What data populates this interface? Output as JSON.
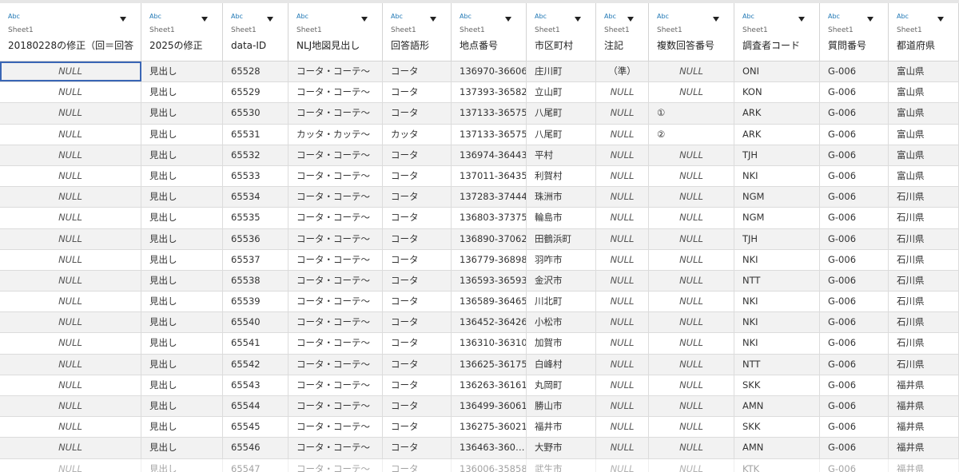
{
  "columns": [
    {
      "type": "Abc",
      "source": "Sheet1",
      "name": "20180228の修正（回＝回答"
    },
    {
      "type": "Abc",
      "source": "Sheet1",
      "name": "2025の修正"
    },
    {
      "type": "Abc",
      "source": "Sheet1",
      "name": "data-ID"
    },
    {
      "type": "Abc",
      "source": "Sheet1",
      "name": "NLJ地図見出し"
    },
    {
      "type": "Abc",
      "source": "Sheet1",
      "name": "回答語形"
    },
    {
      "type": "Abc",
      "source": "Sheet1",
      "name": "地点番号"
    },
    {
      "type": "Abc",
      "source": "Sheet1",
      "name": "市区町村"
    },
    {
      "type": "Abc",
      "source": "Sheet1",
      "name": "注記"
    },
    {
      "type": "Abc",
      "source": "Sheet1",
      "name": "複数回答番号"
    },
    {
      "type": "Abc",
      "source": "Sheet1",
      "name": "調査者コード"
    },
    {
      "type": "Abc",
      "source": "Sheet1",
      "name": "質問番号"
    },
    {
      "type": "Abc",
      "source": "Sheet1",
      "name": "都道府県"
    }
  ],
  "rows": [
    [
      "NULL",
      "見出し",
      "65528",
      "コータ・コーテ〜",
      "コータ",
      "136970-36606",
      "庄川町",
      "（準）",
      "NULL",
      "ONI",
      "G-006",
      "富山県"
    ],
    [
      "NULL",
      "見出し",
      "65529",
      "コータ・コーテ〜",
      "コータ",
      "137393-36582",
      "立山町",
      "NULL",
      "NULL",
      "KON",
      "G-006",
      "富山県"
    ],
    [
      "NULL",
      "見出し",
      "65530",
      "コータ・コーテ〜",
      "コータ",
      "137133-36575",
      "八尾町",
      "NULL",
      "①",
      "ARK",
      "G-006",
      "富山県"
    ],
    [
      "NULL",
      "見出し",
      "65531",
      "カッタ・カッテ〜",
      "カッタ",
      "137133-36575",
      "八尾町",
      "NULL",
      "②",
      "ARK",
      "G-006",
      "富山県"
    ],
    [
      "NULL",
      "見出し",
      "65532",
      "コータ・コーテ〜",
      "コータ",
      "136974-36443",
      "平村",
      "NULL",
      "NULL",
      "TJH",
      "G-006",
      "富山県"
    ],
    [
      "NULL",
      "見出し",
      "65533",
      "コータ・コーテ〜",
      "コータ",
      "137011-36435",
      "利賀村",
      "NULL",
      "NULL",
      "NKI",
      "G-006",
      "富山県"
    ],
    [
      "NULL",
      "見出し",
      "65534",
      "コータ・コーテ〜",
      "コータ",
      "137283-37444",
      "珠洲市",
      "NULL",
      "NULL",
      "NGM",
      "G-006",
      "石川県"
    ],
    [
      "NULL",
      "見出し",
      "65535",
      "コータ・コーテ〜",
      "コータ",
      "136803-37375",
      "輪島市",
      "NULL",
      "NULL",
      "NGM",
      "G-006",
      "石川県"
    ],
    [
      "NULL",
      "見出し",
      "65536",
      "コータ・コーテ〜",
      "コータ",
      "136890-37062",
      "田鶴浜町",
      "NULL",
      "NULL",
      "TJH",
      "G-006",
      "石川県"
    ],
    [
      "NULL",
      "見出し",
      "65537",
      "コータ・コーテ〜",
      "コータ",
      "136779-36898",
      "羽咋市",
      "NULL",
      "NULL",
      "NKI",
      "G-006",
      "石川県"
    ],
    [
      "NULL",
      "見出し",
      "65538",
      "コータ・コーテ〜",
      "コータ",
      "136593-36593",
      "金沢市",
      "NULL",
      "NULL",
      "NTT",
      "G-006",
      "石川県"
    ],
    [
      "NULL",
      "見出し",
      "65539",
      "コータ・コーテ〜",
      "コータ",
      "136589-36465",
      "川北町",
      "NULL",
      "NULL",
      "NKI",
      "G-006",
      "石川県"
    ],
    [
      "NULL",
      "見出し",
      "65540",
      "コータ・コーテ〜",
      "コータ",
      "136452-36426",
      "小松市",
      "NULL",
      "NULL",
      "NKI",
      "G-006",
      "石川県"
    ],
    [
      "NULL",
      "見出し",
      "65541",
      "コータ・コーテ〜",
      "コータ",
      "136310-36310",
      "加賀市",
      "NULL",
      "NULL",
      "NKI",
      "G-006",
      "石川県"
    ],
    [
      "NULL",
      "見出し",
      "65542",
      "コータ・コーテ〜",
      "コータ",
      "136625-36175",
      "白峰村",
      "NULL",
      "NULL",
      "NTT",
      "G-006",
      "石川県"
    ],
    [
      "NULL",
      "見出し",
      "65543",
      "コータ・コーテ〜",
      "コータ",
      "136263-36161",
      "丸岡町",
      "NULL",
      "NULL",
      "SKK",
      "G-006",
      "福井県"
    ],
    [
      "NULL",
      "見出し",
      "65544",
      "コータ・コーテ〜",
      "コータ",
      "136499-36061",
      "勝山市",
      "NULL",
      "NULL",
      "AMN",
      "G-006",
      "福井県"
    ],
    [
      "NULL",
      "見出し",
      "65545",
      "コータ・コーテ〜",
      "コータ",
      "136275-36021",
      "福井市",
      "NULL",
      "NULL",
      "SKK",
      "G-006",
      "福井県"
    ],
    [
      "NULL",
      "見出し",
      "65546",
      "コータ・コーテ〜",
      "コータ",
      "136463-360…",
      "大野市",
      "NULL",
      "NULL",
      "AMN",
      "G-006",
      "福井県"
    ],
    [
      "NULL",
      "見出し",
      "65547",
      "コータ・コーテ〜",
      "コータ",
      "136006-35858",
      "武生市",
      "NULL",
      "NULL",
      "KTK",
      "G-006",
      "福井県"
    ]
  ],
  "selected_cell": {
    "row": 1,
    "column": 1
  },
  "colors": {
    "type_icon": "#1f77b4",
    "selection": "#3a66b5",
    "stripe": "#f2f2f2",
    "grid_line": "#d4d4d4"
  },
  "icons": {
    "column_menu": "caret-down-icon",
    "type": "abc-type-icon"
  }
}
